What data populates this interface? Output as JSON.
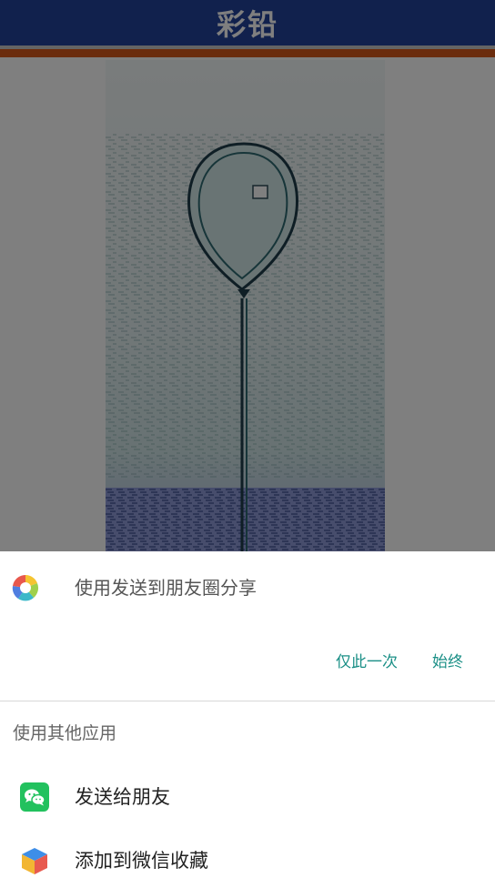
{
  "app": {
    "title": "彩铅"
  },
  "colors": {
    "header": "#22439b",
    "stripe": "#d7581a",
    "accent_button": "#1a8f86",
    "wechat_green": "#22c15e"
  },
  "share_sheet": {
    "default_app_label": "使用发送到朋友圈分享",
    "default_app_icon": "moments-aperture-icon",
    "button_once": "仅此一次",
    "button_always": "始终",
    "other_apps_label": "使用其他应用",
    "apps": [
      {
        "label": "发送给朋友",
        "icon": "wechat-icon"
      },
      {
        "label": "添加到微信收藏",
        "icon": "wechat-favorites-cube-icon"
      }
    ]
  }
}
